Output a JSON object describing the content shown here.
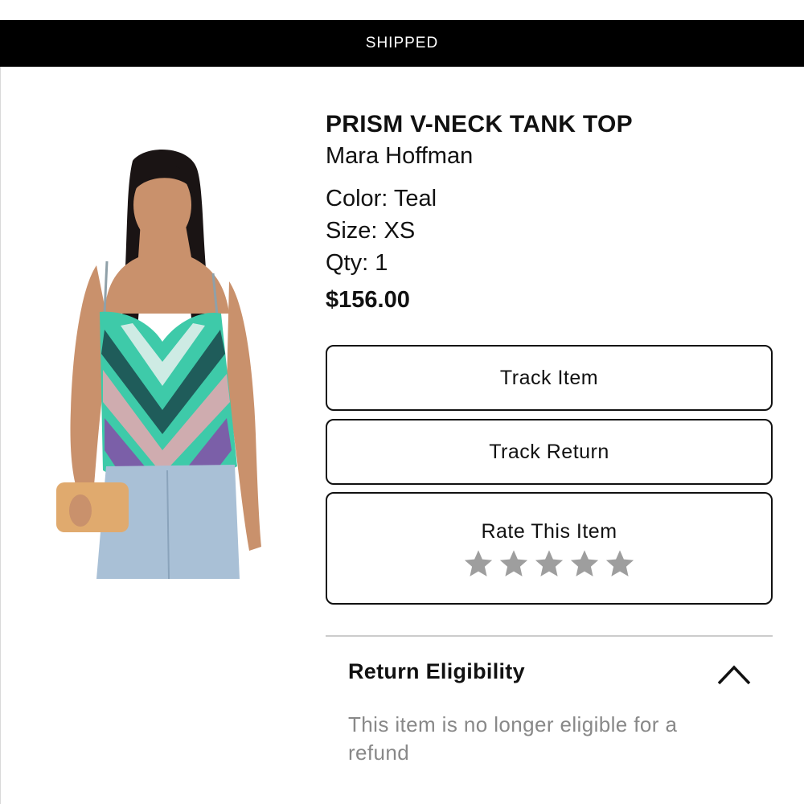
{
  "status_banner": {
    "text": "SHIPPED"
  },
  "product": {
    "title": "PRISM V-NECK TANK TOP",
    "brand": "Mara Hoffman",
    "color": "Color: Teal",
    "size": "Size: XS",
    "qty": "Qty: 1",
    "price": "$156.00",
    "image_icon": "product-photo"
  },
  "actions": {
    "track_item": "Track Item",
    "track_return": "Track Return",
    "rate_label": "Rate This Item",
    "rating": {
      "value": 0,
      "max": 5,
      "star_color": "#9e9e9e"
    }
  },
  "eligibility": {
    "title": "Return Eligibility",
    "message": "This item is no longer eligible for a refund",
    "toggle_icon": "chevron-up-icon"
  },
  "colors": {
    "banner_bg": "#000000",
    "banner_text": "#ffffff",
    "muted_text": "#888888",
    "border": "#111111"
  }
}
